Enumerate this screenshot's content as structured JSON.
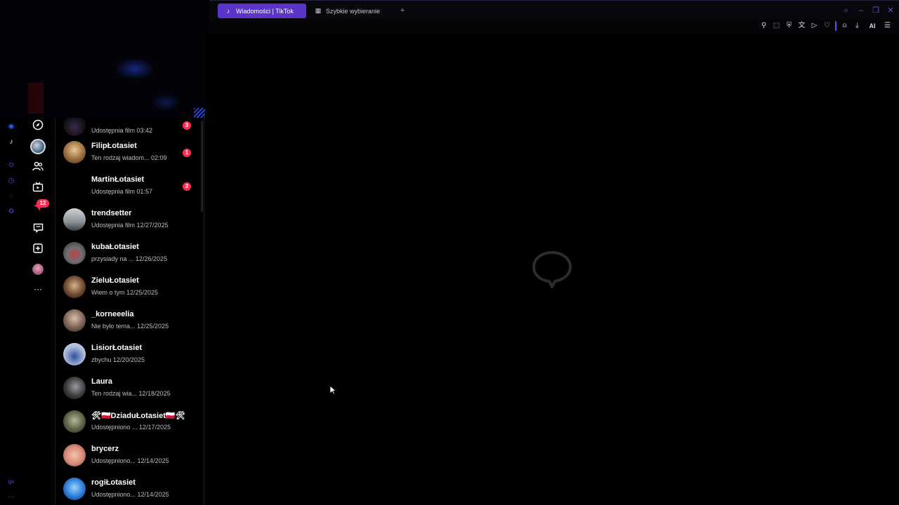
{
  "browser": {
    "tabs": [
      {
        "label": "Wiadomości | TikTok",
        "icon": "tiktok-icon",
        "active": true
      },
      {
        "label": "Szybkie wybieranie",
        "icon": "grid-icon",
        "active": false
      }
    ],
    "new_tab_symbol": "+",
    "toolbar": {
      "ai_label": "AI"
    },
    "accent_color": "#5b34c9"
  },
  "browser_panel": {
    "bottom_label": "gx"
  },
  "rail": {
    "notification_count": "12"
  },
  "conversations": [
    {
      "name": "",
      "preview": "Udostępnia film 03:42",
      "unread": "3",
      "avatar": "partial"
    },
    {
      "name": "FilipŁotasiet",
      "preview": "Ten rodzaj wiadom...   02:09",
      "unread": "1",
      "avatar": "blonde"
    },
    {
      "name": "MartinŁotasiet",
      "preview": "Udostępnia film 01:57",
      "unread": "3",
      "avatar": "none"
    },
    {
      "name": "trendsetter",
      "preview": "Udostępnia film 12/27/2025",
      "unread": "",
      "avatar": "grey"
    },
    {
      "name": "kubaŁotasiet",
      "preview": "przysiady na ...   12/26/2025",
      "unread": "",
      "avatar": "car"
    },
    {
      "name": "ZieluŁotasiet",
      "preview": "Wiem o tym 12/25/2025",
      "unread": "",
      "avatar": "face"
    },
    {
      "name": "_korneeelia",
      "preview": "Nie było tema...   12/25/2025",
      "unread": "",
      "avatar": "girl"
    },
    {
      "name": "LisiorŁotasiet",
      "preview": "zbychu 12/20/2025",
      "unread": "",
      "avatar": "blue"
    },
    {
      "name": "Laura",
      "preview": "Ten rodzaj wia...   12/18/2025",
      "unread": "",
      "avatar": "dark"
    },
    {
      "name": "🛠🇵🇱DziaduŁotasiet🇵🇱🛠",
      "preview": "Udostępniono ...   12/17/2025",
      "unread": "",
      "avatar": "green"
    },
    {
      "name": "brycerz",
      "preview": "Udostępniono...   12/14/2025",
      "unread": "",
      "avatar": "pink"
    },
    {
      "name": "rogiŁotasiet",
      "preview": "Udostępniono...   12/14/2025",
      "unread": "",
      "avatar": "sky"
    }
  ]
}
